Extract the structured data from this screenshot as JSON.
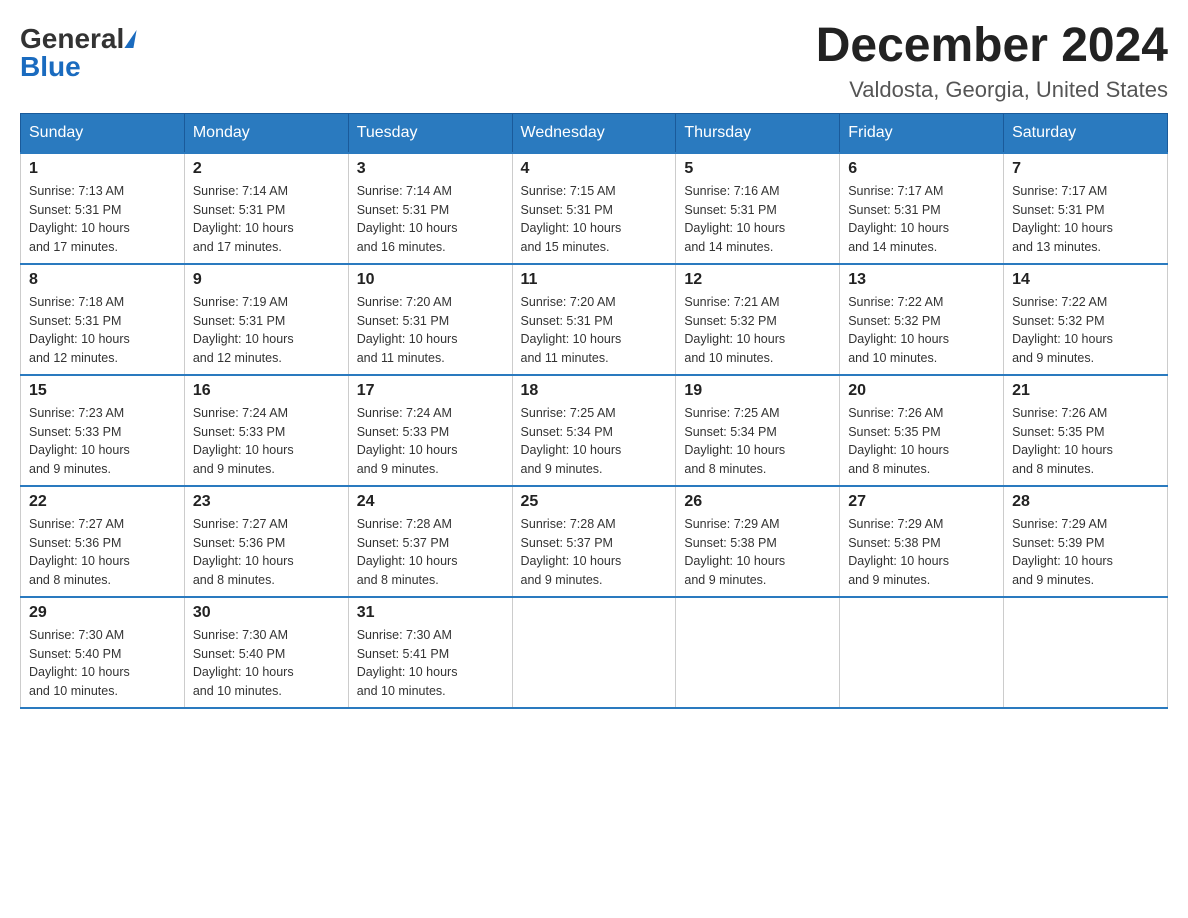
{
  "logo": {
    "general": "General",
    "blue": "Blue"
  },
  "title": {
    "month_year": "December 2024",
    "location": "Valdosta, Georgia, United States"
  },
  "headers": [
    "Sunday",
    "Monday",
    "Tuesday",
    "Wednesday",
    "Thursday",
    "Friday",
    "Saturday"
  ],
  "weeks": [
    [
      {
        "day": "1",
        "sunrise": "7:13 AM",
        "sunset": "5:31 PM",
        "daylight": "10 hours and 17 minutes."
      },
      {
        "day": "2",
        "sunrise": "7:14 AM",
        "sunset": "5:31 PM",
        "daylight": "10 hours and 17 minutes."
      },
      {
        "day": "3",
        "sunrise": "7:14 AM",
        "sunset": "5:31 PM",
        "daylight": "10 hours and 16 minutes."
      },
      {
        "day": "4",
        "sunrise": "7:15 AM",
        "sunset": "5:31 PM",
        "daylight": "10 hours and 15 minutes."
      },
      {
        "day": "5",
        "sunrise": "7:16 AM",
        "sunset": "5:31 PM",
        "daylight": "10 hours and 14 minutes."
      },
      {
        "day": "6",
        "sunrise": "7:17 AM",
        "sunset": "5:31 PM",
        "daylight": "10 hours and 14 minutes."
      },
      {
        "day": "7",
        "sunrise": "7:17 AM",
        "sunset": "5:31 PM",
        "daylight": "10 hours and 13 minutes."
      }
    ],
    [
      {
        "day": "8",
        "sunrise": "7:18 AM",
        "sunset": "5:31 PM",
        "daylight": "10 hours and 12 minutes."
      },
      {
        "day": "9",
        "sunrise": "7:19 AM",
        "sunset": "5:31 PM",
        "daylight": "10 hours and 12 minutes."
      },
      {
        "day": "10",
        "sunrise": "7:20 AM",
        "sunset": "5:31 PM",
        "daylight": "10 hours and 11 minutes."
      },
      {
        "day": "11",
        "sunrise": "7:20 AM",
        "sunset": "5:31 PM",
        "daylight": "10 hours and 11 minutes."
      },
      {
        "day": "12",
        "sunrise": "7:21 AM",
        "sunset": "5:32 PM",
        "daylight": "10 hours and 10 minutes."
      },
      {
        "day": "13",
        "sunrise": "7:22 AM",
        "sunset": "5:32 PM",
        "daylight": "10 hours and 10 minutes."
      },
      {
        "day": "14",
        "sunrise": "7:22 AM",
        "sunset": "5:32 PM",
        "daylight": "10 hours and 9 minutes."
      }
    ],
    [
      {
        "day": "15",
        "sunrise": "7:23 AM",
        "sunset": "5:33 PM",
        "daylight": "10 hours and 9 minutes."
      },
      {
        "day": "16",
        "sunrise": "7:24 AM",
        "sunset": "5:33 PM",
        "daylight": "10 hours and 9 minutes."
      },
      {
        "day": "17",
        "sunrise": "7:24 AM",
        "sunset": "5:33 PM",
        "daylight": "10 hours and 9 minutes."
      },
      {
        "day": "18",
        "sunrise": "7:25 AM",
        "sunset": "5:34 PM",
        "daylight": "10 hours and 9 minutes."
      },
      {
        "day": "19",
        "sunrise": "7:25 AM",
        "sunset": "5:34 PM",
        "daylight": "10 hours and 8 minutes."
      },
      {
        "day": "20",
        "sunrise": "7:26 AM",
        "sunset": "5:35 PM",
        "daylight": "10 hours and 8 minutes."
      },
      {
        "day": "21",
        "sunrise": "7:26 AM",
        "sunset": "5:35 PM",
        "daylight": "10 hours and 8 minutes."
      }
    ],
    [
      {
        "day": "22",
        "sunrise": "7:27 AM",
        "sunset": "5:36 PM",
        "daylight": "10 hours and 8 minutes."
      },
      {
        "day": "23",
        "sunrise": "7:27 AM",
        "sunset": "5:36 PM",
        "daylight": "10 hours and 8 minutes."
      },
      {
        "day": "24",
        "sunrise": "7:28 AM",
        "sunset": "5:37 PM",
        "daylight": "10 hours and 8 minutes."
      },
      {
        "day": "25",
        "sunrise": "7:28 AM",
        "sunset": "5:37 PM",
        "daylight": "10 hours and 9 minutes."
      },
      {
        "day": "26",
        "sunrise": "7:29 AM",
        "sunset": "5:38 PM",
        "daylight": "10 hours and 9 minutes."
      },
      {
        "day": "27",
        "sunrise": "7:29 AM",
        "sunset": "5:38 PM",
        "daylight": "10 hours and 9 minutes."
      },
      {
        "day": "28",
        "sunrise": "7:29 AM",
        "sunset": "5:39 PM",
        "daylight": "10 hours and 9 minutes."
      }
    ],
    [
      {
        "day": "29",
        "sunrise": "7:30 AM",
        "sunset": "5:40 PM",
        "daylight": "10 hours and 10 minutes."
      },
      {
        "day": "30",
        "sunrise": "7:30 AM",
        "sunset": "5:40 PM",
        "daylight": "10 hours and 10 minutes."
      },
      {
        "day": "31",
        "sunrise": "7:30 AM",
        "sunset": "5:41 PM",
        "daylight": "10 hours and 10 minutes."
      },
      null,
      null,
      null,
      null
    ]
  ],
  "labels": {
    "sunrise": "Sunrise: ",
    "sunset": "Sunset: ",
    "daylight": "Daylight: "
  }
}
